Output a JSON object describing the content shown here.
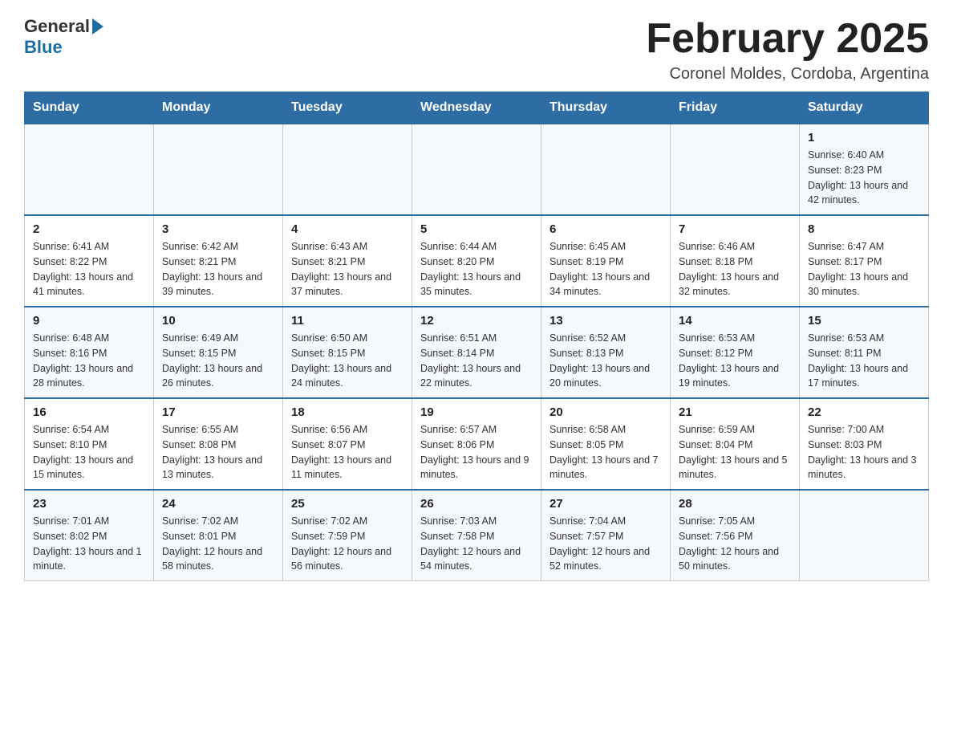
{
  "logo": {
    "general": "General",
    "blue": "Blue"
  },
  "title": "February 2025",
  "location": "Coronel Moldes, Cordoba, Argentina",
  "days_of_week": [
    "Sunday",
    "Monday",
    "Tuesday",
    "Wednesday",
    "Thursday",
    "Friday",
    "Saturday"
  ],
  "weeks": [
    [
      {
        "day": "",
        "info": ""
      },
      {
        "day": "",
        "info": ""
      },
      {
        "day": "",
        "info": ""
      },
      {
        "day": "",
        "info": ""
      },
      {
        "day": "",
        "info": ""
      },
      {
        "day": "",
        "info": ""
      },
      {
        "day": "1",
        "info": "Sunrise: 6:40 AM\nSunset: 8:23 PM\nDaylight: 13 hours and 42 minutes."
      }
    ],
    [
      {
        "day": "2",
        "info": "Sunrise: 6:41 AM\nSunset: 8:22 PM\nDaylight: 13 hours and 41 minutes."
      },
      {
        "day": "3",
        "info": "Sunrise: 6:42 AM\nSunset: 8:21 PM\nDaylight: 13 hours and 39 minutes."
      },
      {
        "day": "4",
        "info": "Sunrise: 6:43 AM\nSunset: 8:21 PM\nDaylight: 13 hours and 37 minutes."
      },
      {
        "day": "5",
        "info": "Sunrise: 6:44 AM\nSunset: 8:20 PM\nDaylight: 13 hours and 35 minutes."
      },
      {
        "day": "6",
        "info": "Sunrise: 6:45 AM\nSunset: 8:19 PM\nDaylight: 13 hours and 34 minutes."
      },
      {
        "day": "7",
        "info": "Sunrise: 6:46 AM\nSunset: 8:18 PM\nDaylight: 13 hours and 32 minutes."
      },
      {
        "day": "8",
        "info": "Sunrise: 6:47 AM\nSunset: 8:17 PM\nDaylight: 13 hours and 30 minutes."
      }
    ],
    [
      {
        "day": "9",
        "info": "Sunrise: 6:48 AM\nSunset: 8:16 PM\nDaylight: 13 hours and 28 minutes."
      },
      {
        "day": "10",
        "info": "Sunrise: 6:49 AM\nSunset: 8:15 PM\nDaylight: 13 hours and 26 minutes."
      },
      {
        "day": "11",
        "info": "Sunrise: 6:50 AM\nSunset: 8:15 PM\nDaylight: 13 hours and 24 minutes."
      },
      {
        "day": "12",
        "info": "Sunrise: 6:51 AM\nSunset: 8:14 PM\nDaylight: 13 hours and 22 minutes."
      },
      {
        "day": "13",
        "info": "Sunrise: 6:52 AM\nSunset: 8:13 PM\nDaylight: 13 hours and 20 minutes."
      },
      {
        "day": "14",
        "info": "Sunrise: 6:53 AM\nSunset: 8:12 PM\nDaylight: 13 hours and 19 minutes."
      },
      {
        "day": "15",
        "info": "Sunrise: 6:53 AM\nSunset: 8:11 PM\nDaylight: 13 hours and 17 minutes."
      }
    ],
    [
      {
        "day": "16",
        "info": "Sunrise: 6:54 AM\nSunset: 8:10 PM\nDaylight: 13 hours and 15 minutes."
      },
      {
        "day": "17",
        "info": "Sunrise: 6:55 AM\nSunset: 8:08 PM\nDaylight: 13 hours and 13 minutes."
      },
      {
        "day": "18",
        "info": "Sunrise: 6:56 AM\nSunset: 8:07 PM\nDaylight: 13 hours and 11 minutes."
      },
      {
        "day": "19",
        "info": "Sunrise: 6:57 AM\nSunset: 8:06 PM\nDaylight: 13 hours and 9 minutes."
      },
      {
        "day": "20",
        "info": "Sunrise: 6:58 AM\nSunset: 8:05 PM\nDaylight: 13 hours and 7 minutes."
      },
      {
        "day": "21",
        "info": "Sunrise: 6:59 AM\nSunset: 8:04 PM\nDaylight: 13 hours and 5 minutes."
      },
      {
        "day": "22",
        "info": "Sunrise: 7:00 AM\nSunset: 8:03 PM\nDaylight: 13 hours and 3 minutes."
      }
    ],
    [
      {
        "day": "23",
        "info": "Sunrise: 7:01 AM\nSunset: 8:02 PM\nDaylight: 13 hours and 1 minute."
      },
      {
        "day": "24",
        "info": "Sunrise: 7:02 AM\nSunset: 8:01 PM\nDaylight: 12 hours and 58 minutes."
      },
      {
        "day": "25",
        "info": "Sunrise: 7:02 AM\nSunset: 7:59 PM\nDaylight: 12 hours and 56 minutes."
      },
      {
        "day": "26",
        "info": "Sunrise: 7:03 AM\nSunset: 7:58 PM\nDaylight: 12 hours and 54 minutes."
      },
      {
        "day": "27",
        "info": "Sunrise: 7:04 AM\nSunset: 7:57 PM\nDaylight: 12 hours and 52 minutes."
      },
      {
        "day": "28",
        "info": "Sunrise: 7:05 AM\nSunset: 7:56 PM\nDaylight: 12 hours and 50 minutes."
      },
      {
        "day": "",
        "info": ""
      }
    ]
  ]
}
